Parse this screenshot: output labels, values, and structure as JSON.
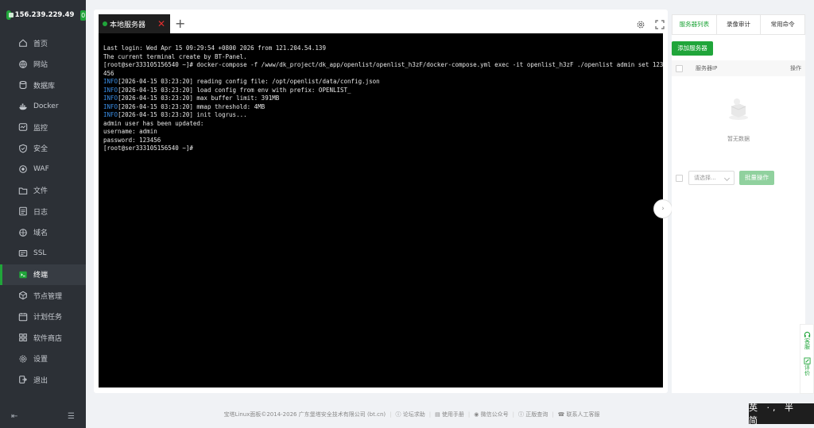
{
  "sidebar": {
    "ip": "156.239.229.49",
    "badge": "0",
    "items": [
      {
        "label": "首页",
        "icon": "home-icon"
      },
      {
        "label": "网站",
        "icon": "globe-icon"
      },
      {
        "label": "数据库",
        "icon": "database-icon"
      },
      {
        "label": "Docker",
        "icon": "docker-icon"
      },
      {
        "label": "监控",
        "icon": "monitor-icon"
      },
      {
        "label": "安全",
        "icon": "shield-icon"
      },
      {
        "label": "WAF",
        "icon": "waf-icon"
      },
      {
        "label": "文件",
        "icon": "folder-icon"
      },
      {
        "label": "日志",
        "icon": "log-icon"
      },
      {
        "label": "域名",
        "icon": "domain-icon"
      },
      {
        "label": "SSL",
        "icon": "ssl-icon"
      },
      {
        "label": "终端",
        "icon": "terminal-icon",
        "active": true
      },
      {
        "label": "节点管理",
        "icon": "node-icon"
      },
      {
        "label": "计划任务",
        "icon": "calendar-icon"
      },
      {
        "label": "软件商店",
        "icon": "store-icon"
      },
      {
        "label": "设置",
        "icon": "gear-icon"
      },
      {
        "label": "退出",
        "icon": "logout-icon"
      }
    ]
  },
  "terminal": {
    "tab_label": "本地服务器",
    "lines": [
      {
        "text": "Last login: Wed Apr 15 09:29:54 +0800 2026 from 121.204.54.139"
      },
      {
        "text": "The current terminal create by BT-Panel."
      },
      {
        "text": "[root@ser333105156540 ~]# docker-compose -f /www/dk_project/dk_app/openlist/openlist_h3zF/docker-compose.yml exec -it openlist_h3zF ./openlist admin set 123"
      },
      {
        "text": "456"
      },
      {
        "prefix": "INFO",
        "text": "[2026-04-15 03:23:20] reading config file: /opt/openlist/data/config.json"
      },
      {
        "prefix": "INFO",
        "text": "[2026-04-15 03:23:20] load config from env with prefix: OPENLIST_"
      },
      {
        "prefix": "INFO",
        "text": "[2026-04-15 03:23:20] max buffer limit: 391MB"
      },
      {
        "prefix": "INFO",
        "text": "[2026-04-15 03:23:20] mmap threshold: 4MB"
      },
      {
        "prefix": "INFO",
        "text": "[2026-04-15 03:23:20] init logrus..."
      },
      {
        "text": "admin user has been updated:"
      },
      {
        "text": "username: admin"
      },
      {
        "text": "password: 123456"
      },
      {
        "text": "[root@ser333105156540 ~]#"
      }
    ]
  },
  "right_panel": {
    "tabs": [
      {
        "label": "服务器列表",
        "active": true
      },
      {
        "label": "录像审计"
      },
      {
        "label": "常用命令"
      }
    ],
    "add_button": "添加服务器",
    "table": {
      "col_ip": "服务器IP",
      "col_ops": "操作"
    },
    "empty_text": "暂无数据",
    "select_placeholder": "请选择...",
    "batch_button": "批量操作"
  },
  "float_widget": {
    "service": "客服",
    "feedback": "评价"
  },
  "footer": {
    "copyright": "宝塔Linux面板©2014-2026 广东堡塔安全技术有限公司 (bt.cn)",
    "links": [
      "论坛求助",
      "使用手册",
      "微信公众号",
      "正版查询",
      "联系人工客服"
    ]
  },
  "ime": "英 ·, 半 简",
  "colors": {
    "accent": "#20a53a",
    "sidebar_bg": "#2c3036",
    "info_blue": "#3a8ee6",
    "close_red": "#e02e2e"
  }
}
